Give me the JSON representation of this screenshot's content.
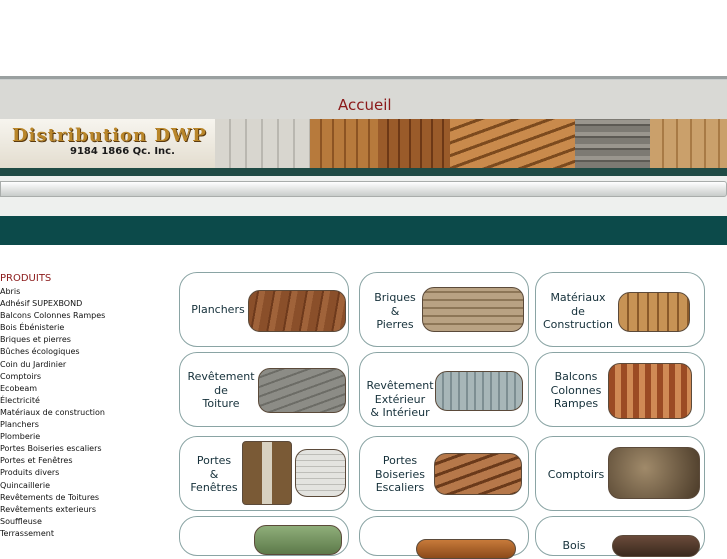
{
  "header": {
    "title": "Accueil"
  },
  "logo": {
    "title": "Distribution DWP",
    "subtitle": "9184 1866 Qc. Inc."
  },
  "sidebar": {
    "title": "PRODUITS",
    "items": [
      "Abris",
      "Adhésif SUPEXBOND",
      "Balcons Colonnes Rampes",
      "Bois Ébénisterie",
      "Briques et pierres",
      "Bûches écologiques",
      "Coin du Jardinier",
      "Comptoirs",
      "Ecobeam",
      "Électricité",
      "Matériaux de construction",
      "Planchers",
      "Plomberie",
      "Portes Boiseries escaliers",
      "Portes et Fenêtres",
      "Produits divers",
      "Quincaillerie",
      "Revêtements de Toitures",
      "Revêtements exterieurs",
      "Souffleuse",
      "Terrassement"
    ]
  },
  "tiles": [
    {
      "label": "Planchers"
    },
    {
      "label": "Briques\n&\nPierres"
    },
    {
      "label": "Matériaux\nde\nConstruction"
    },
    {
      "label": "Revêtement\nde\nToiture"
    },
    {
      "label": "Revêtement\nExtérieur\n& Intérieur"
    },
    {
      "label": "Balcons\nColonnes\nRampes"
    },
    {
      "label": "Portes\n&\nFenêtres"
    },
    {
      "label": "Portes\nBoiseries\nEscaliers"
    },
    {
      "label": "Comptoirs"
    },
    {
      "label": ""
    },
    {
      "label": ""
    },
    {
      "label": "Bois"
    }
  ],
  "colors": {
    "accent_dark": "#0c4a4a",
    "title_red": "#8b1a1a",
    "logo_gold": "#b9862a"
  }
}
